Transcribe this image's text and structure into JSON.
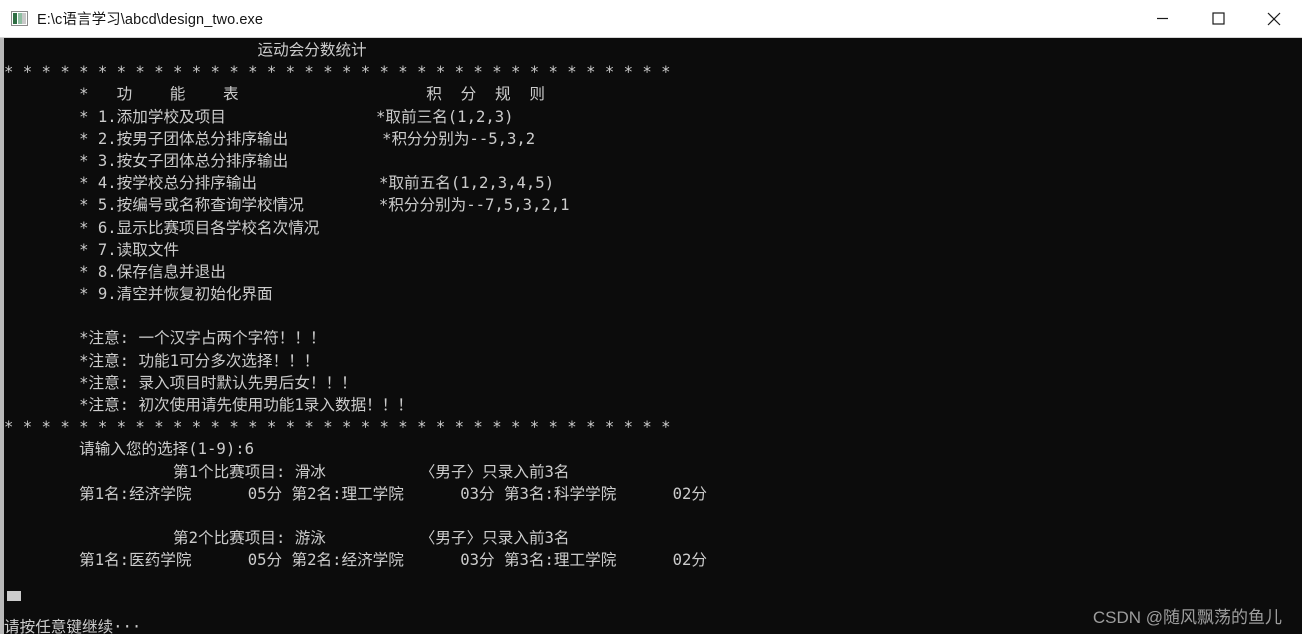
{
  "titlebar": {
    "path": "E:\\c语言学习\\abcd\\design_two.exe",
    "icon": "console-app-icon",
    "minimize_label": "—",
    "maximize_label": "□",
    "close_label": "✕"
  },
  "console": {
    "background_color": "#0c0c0c",
    "text_color": "#cccccc",
    "lines": [
      "                           运动会分数统计",
      "* * * * * * * * * * * * * * * * * * * * * * * * * * * * * * * * * * * *",
      "        *   功    能    表                    积  分  规  则",
      "        * 1.添加学校及项目                *取前三名(1,2,3)",
      "        * 2.按男子团体总分排序输出          *积分分别为--5,3,2",
      "        * 3.按女子团体总分排序输出",
      "        * 4.按学校总分排序输出             *取前五名(1,2,3,4,5)",
      "        * 5.按编号或名称查询学校情况        *积分分别为--7,5,3,2,1",
      "        * 6.显示比赛项目各学校名次情况",
      "        * 7.读取文件",
      "        * 8.保存信息并退出",
      "        * 9.清空并恢复初始化界面",
      "",
      "        *注意: 一个汉字占两个字符！！！",
      "        *注意: 功能1可分多次选择！！！",
      "        *注意: 录入项目时默认先男后女！！！",
      "        *注意: 初次使用请先使用功能1录入数据！！！",
      "* * * * * * * * * * * * * * * * * * * * * * * * * * * * * * * * * * * *",
      "        请输入您的选择(1-9):6",
      "                  第1个比赛项目: 滑冰          〈男子〉只录入前3名",
      "        第1名:经济学院      05分 第2名:理工学院      03分 第3名:科学学院      02分",
      "",
      "                  第2个比赛项目: 游泳          〈男子〉只录入前3名",
      "        第1名:医药学院      05分 第2名:经济学院      03分 第3名:理工学院      02分",
      "",
      "",
      "请按任意键继续···"
    ],
    "cursor_visible": true
  },
  "watermark": {
    "text": "CSDN @随风飘荡的鱼儿"
  }
}
